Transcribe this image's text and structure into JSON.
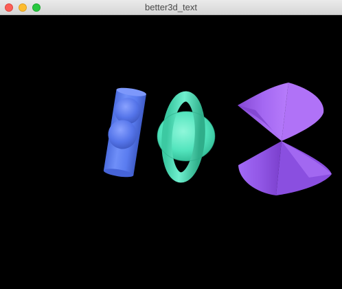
{
  "window": {
    "title": "better3d_text",
    "buttons": [
      {
        "name": "close",
        "color": "#fc5f57",
        "border": "#de4840"
      },
      {
        "name": "minimize",
        "color": "#fdbc2e",
        "border": "#dea123"
      },
      {
        "name": "zoom",
        "color": "#28c840",
        "border": "#1ea932"
      }
    ]
  },
  "scene": {
    "background": "#000000",
    "objects": [
      {
        "name": "cylinder-with-spheres",
        "color": "#5b7ff5"
      },
      {
        "name": "sphere-with-torus",
        "color": "#4fe8c0"
      },
      {
        "name": "double-cone",
        "color": "#a866f5"
      }
    ]
  }
}
